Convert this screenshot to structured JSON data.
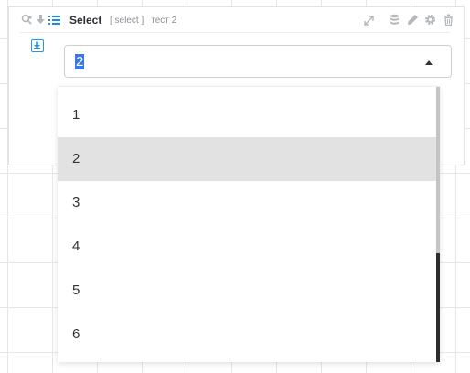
{
  "widget": {
    "title": "Select",
    "type_tag": "[ select ]",
    "name": "тест 2",
    "header_left_icons": [
      "search-settings-icon",
      "download-icon",
      "list-icon"
    ],
    "header_right_icons": [
      "expand-icon",
      "database-icon",
      "edit-icon",
      "gear-icon",
      "trash-icon"
    ]
  },
  "field": {
    "indicator_icon": "download-box-icon"
  },
  "select": {
    "value": "2",
    "caret_icon": "caret-up-icon",
    "options": [
      "1",
      "2",
      "3",
      "4",
      "5",
      "6"
    ],
    "selected_index": 1
  },
  "colors": {
    "accent": "#2196f3",
    "selection": "#3b78e7",
    "option_hover": "#e2e2e3"
  }
}
